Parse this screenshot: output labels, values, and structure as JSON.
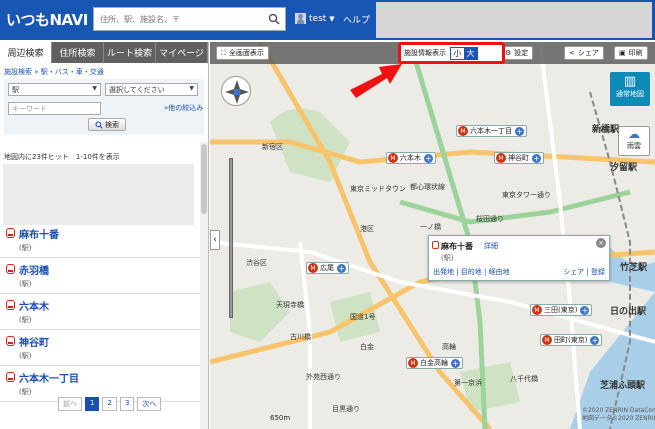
{
  "header": {
    "logo": "いつもNAVI",
    "search_placeholder": "住所、駅、施設名、〒",
    "user": "test",
    "help": "ヘルプ"
  },
  "left": {
    "tabs": [
      "周辺検索",
      "住所検索",
      "ルート検索",
      "マイページ"
    ],
    "breadcrumb": "施設検索 » 駅・バス・車・交通",
    "form": {
      "select1": "駅",
      "select2": "選択してください",
      "keyword_placeholder": "キーワード",
      "refine": "»他の絞込み",
      "search_btn": "検索"
    },
    "hits": "地図内に23件ヒット　1-10件を表示",
    "results": [
      {
        "name": "麻布十番",
        "type": "(駅)"
      },
      {
        "name": "赤羽橋",
        "type": "(駅)"
      },
      {
        "name": "六本木",
        "type": "(駅)"
      },
      {
        "name": "神谷町",
        "type": "(駅)"
      },
      {
        "name": "六本木一丁目",
        "type": "(駅)"
      }
    ],
    "pager": {
      "prev": "前へ",
      "pages": [
        "1",
        "2",
        "3"
      ],
      "next": "次へ"
    }
  },
  "map": {
    "toolbar": {
      "fullscreen": "全画面表示",
      "facility": "施設情報表示",
      "small": "小",
      "large": "大",
      "settings": "設定",
      "share": "シェア",
      "print": "印刷"
    },
    "maptype": "通常地図",
    "rain": "雨雲",
    "scale": "650m",
    "stations": [
      "六本木一丁目",
      "六本木",
      "神谷町",
      "広尾",
      "白金高輪",
      "三田(東京)",
      "田町(東京)"
    ],
    "labels": [
      "東京ミッドタウン",
      "都心環状線",
      "東京タワー通り",
      "桜田通り",
      "新橋駅",
      "汐留駅",
      "竹芝駅",
      "日の出駅",
      "芝浦ふ頭駅",
      "第一京浜",
      "目黒通り",
      "外苑西通り",
      "天現寺橋",
      "渋谷区",
      "港区",
      "国道1号",
      "新宿区",
      "八千代橋",
      "古川橋",
      "一ノ橋",
      "高輪",
      "白金"
    ],
    "popup": {
      "title": "麻布十番",
      "detail": "詳細",
      "kind": "(駅)",
      "links": "出発地 | 目的地 | 経由地",
      "links2": "シェア | 登録"
    },
    "copyright": "©2020 ZENRIN DataCom\n地図データ©2020 ZENRIN"
  },
  "colors": {
    "brand": "#1856b4",
    "highlight": "#ee1111",
    "station": "#cc3311"
  }
}
